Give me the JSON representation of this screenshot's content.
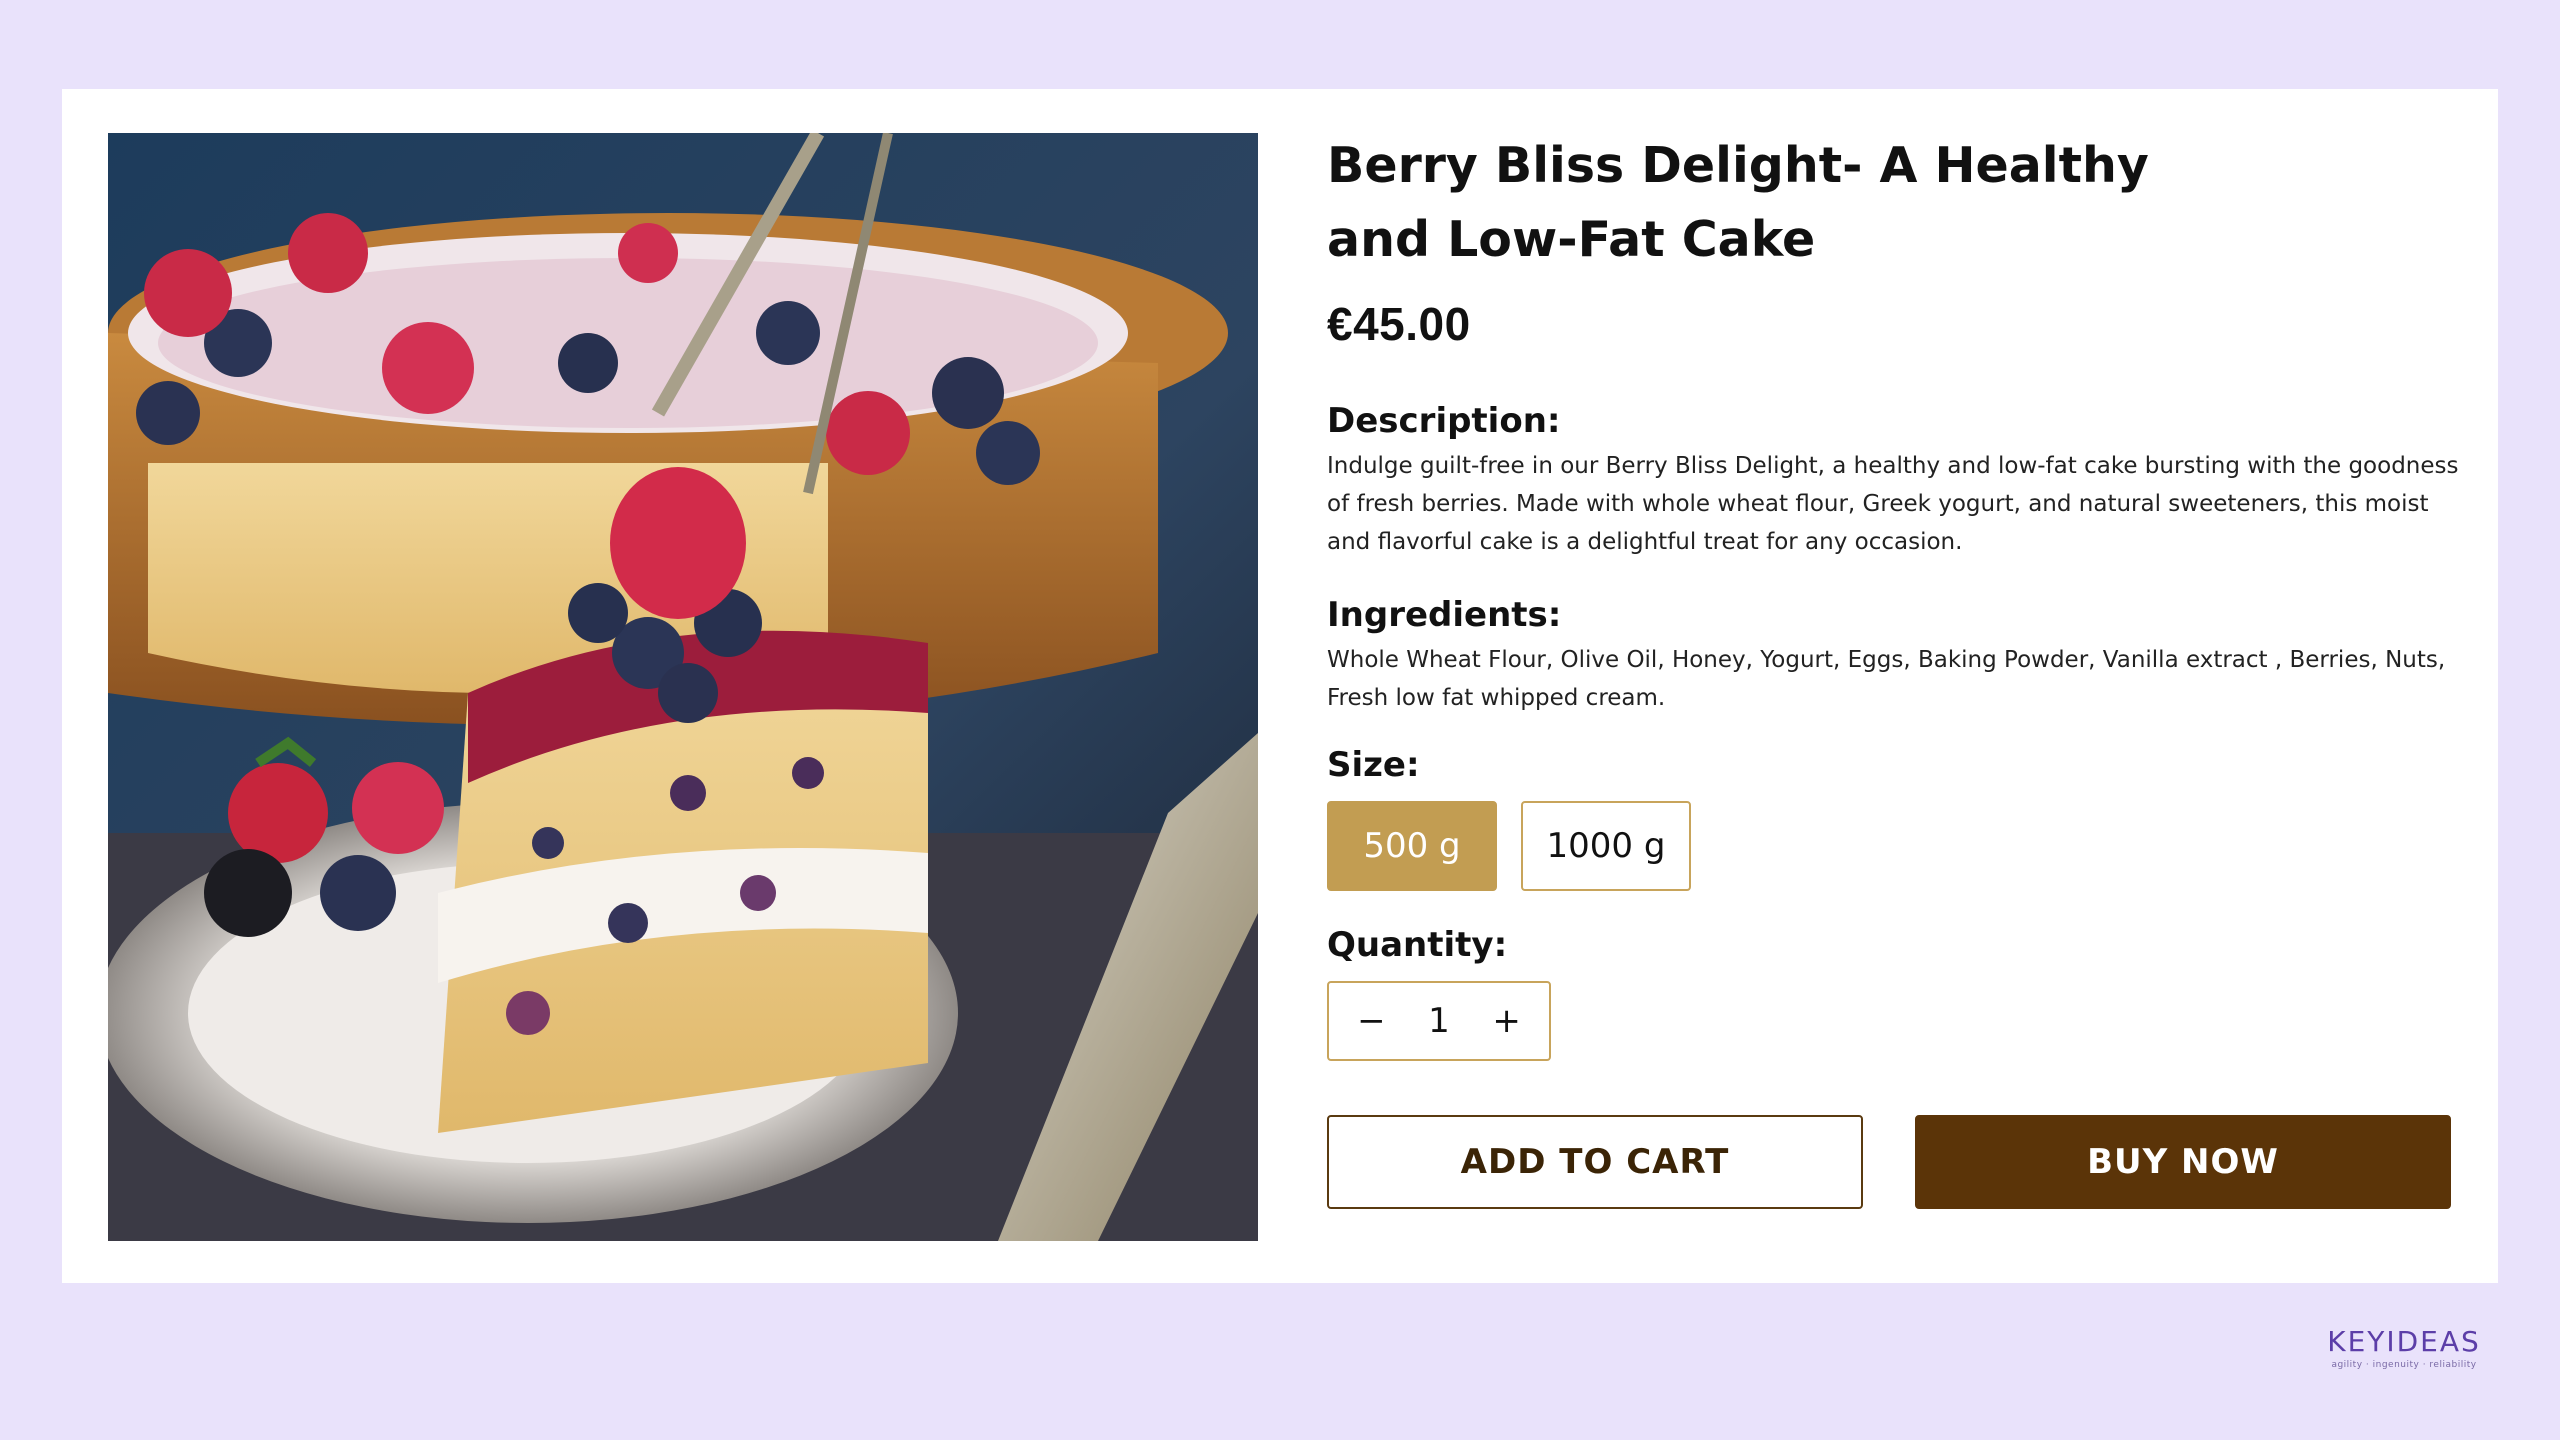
{
  "product": {
    "title": "Berry Bliss Delight- A Healthy and Low-Fat Cake",
    "price": "€45.00",
    "image_alt": "cake-photo",
    "description_label": "Description:",
    "description_text": "Indulge guilt-free in our Berry Bliss Delight, a healthy and low-fat cake bursting with the goodness of fresh berries. Made with whole wheat flour, Greek yogurt, and natural sweeteners, this moist and flavorful cake is a delightful treat for any occasion.",
    "ingredients_label": "Ingredients:",
    "ingredients_text": "Whole Wheat Flour, Olive Oil, Honey, Yogurt, Eggs, Baking Powder, Vanilla extract , Berries, Nuts, Fresh low fat whipped cream.",
    "size_label": "Size:",
    "sizes": [
      {
        "label": "500 g",
        "selected": true
      },
      {
        "label": "1000 g",
        "selected": false
      }
    ],
    "quantity_label": "Quantity:",
    "quantity_minus": "−",
    "quantity_value": "1",
    "quantity_plus": "+",
    "add_to_cart_label": "ADD TO CART",
    "buy_now_label": "BUY NOW"
  },
  "brand": {
    "name": "KEYIDEAS",
    "tagline": "agility · ingenuity · reliability"
  },
  "colors": {
    "background": "#e9e2fb",
    "accent_gold": "#c29d52",
    "button_brown": "#5b3408"
  },
  "icons": {
    "minus": "minus-icon",
    "plus": "plus-icon"
  }
}
